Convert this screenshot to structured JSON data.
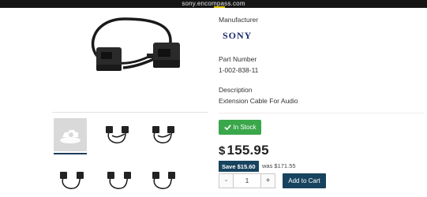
{
  "browser": {
    "url": "sony.encompass.com"
  },
  "product": {
    "manufacturer_label": "Manufacturer",
    "manufacturer_logo": "SONY",
    "part_number_label": "Part Number",
    "part_number": "1-002-838-11",
    "description_label": "Description",
    "description": "Extension Cable For Audio"
  },
  "purchase": {
    "stock_status": "In Stock",
    "price": "155.95",
    "currency_symbol": "$",
    "save_text": "Save $15.60",
    "was_text": "was $171.55",
    "qty_minus": "-",
    "qty_value": "1",
    "qty_plus": "+",
    "add_to_cart": "Add to Cart"
  },
  "colors": {
    "stock_green": "#3aa74b",
    "navy": "#17435e",
    "sony_blue": "#1a2a6c"
  },
  "gallery": {
    "thumbnail_count": 6,
    "thumbnails": [
      "placeholder-image-icon",
      "cable-icon",
      "cable-icon",
      "cable-icon",
      "cable-icon",
      "cable-icon"
    ]
  }
}
